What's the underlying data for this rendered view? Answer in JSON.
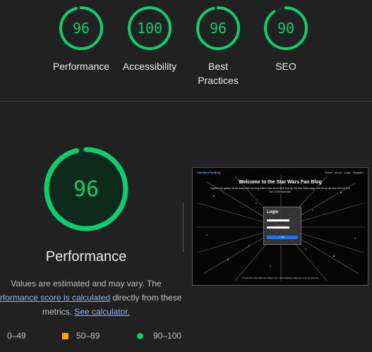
{
  "colors": {
    "pass": "#0cce6b",
    "average": "#ffa400",
    "background": "#212121"
  },
  "summary": [
    {
      "label": "Performance",
      "score": 96
    },
    {
      "label": "Accessibility",
      "score": 100
    },
    {
      "label": "Best\nPractices",
      "score": 96
    },
    {
      "label": "SEO",
      "score": 90
    }
  ],
  "detail": {
    "score": 96,
    "title": "Performance",
    "desc_1": "Values are estimated and may vary. The",
    "desc_link_1": "performance score is calculated",
    "desc_2": "directly from these",
    "desc_3": "metrics.",
    "desc_link_2": "See calculator."
  },
  "legend": {
    "fail_label": "0–49",
    "average_label": "50–89",
    "pass_label": "90–100"
  },
  "screenshot": {
    "logo": "StarWarsFanBlog",
    "nav_links": "Home About Login Register",
    "hero_title": "Welcome to the Star Wars Fan Blog",
    "hero_subtitle": "Explore the galaxy far far away with our blog where fans share their love for the Star Wars saga. Join us as we dive into the rich lore of the franchise",
    "login_title": "Login",
    "login_button": "Login",
    "footer": "Powered by Star Wars Fan Blog | Fan-made Website | May the Force be with you"
  }
}
